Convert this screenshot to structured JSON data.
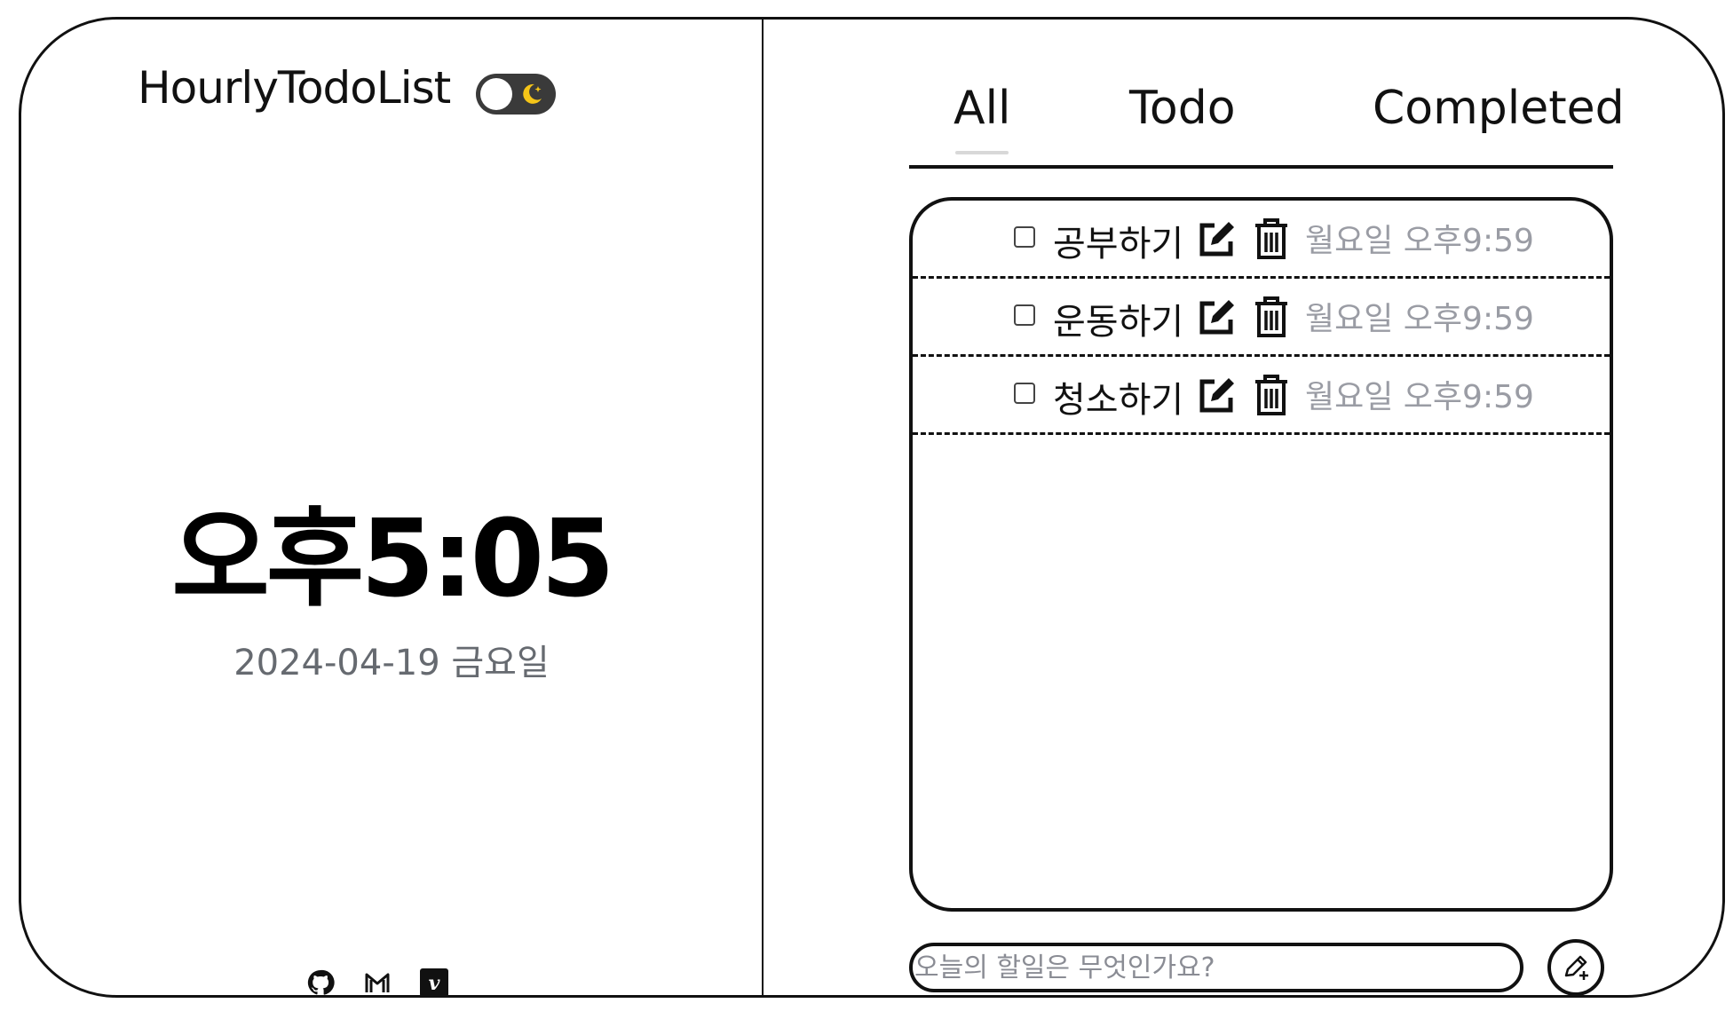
{
  "app": {
    "title": "HourlyTodoList",
    "theme_toggle": "dark-mode-toggle"
  },
  "clock": {
    "time": "오후5:05",
    "date": "2024-04-19 금요일"
  },
  "social": [
    {
      "icon": "github-icon"
    },
    {
      "icon": "gmail-icon"
    },
    {
      "icon": "velog-icon"
    }
  ],
  "tabs": [
    {
      "label": "All",
      "active": true
    },
    {
      "label": "Todo",
      "active": false
    },
    {
      "label": "Completed",
      "active": false
    }
  ],
  "todos": [
    {
      "label": "공부하기",
      "time": "월요일 오후9:59",
      "checked": false
    },
    {
      "label": "운동하기",
      "time": "월요일 오후9:59",
      "checked": false
    },
    {
      "label": "청소하기",
      "time": "월요일 오후9:59",
      "checked": false
    }
  ],
  "input": {
    "placeholder": "오늘의 할일은 무엇인가요?",
    "value": ""
  },
  "colors": {
    "border": "#111111",
    "muted_text": "#9a9ca4",
    "date_text": "#666a70",
    "toggle_bg": "#3a3a3a",
    "moon": "#f5c518"
  }
}
